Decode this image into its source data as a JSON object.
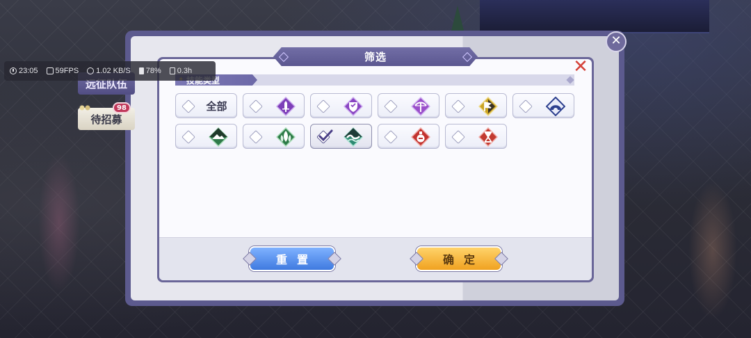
{
  "status": {
    "time": "23:05",
    "fps": "59FPS",
    "network": "1.02 KB/S",
    "battery": "78%",
    "session": "0.3h"
  },
  "side": {
    "expedition_label": "远征队伍",
    "recruit_label": "待招募",
    "recruit_count": "98"
  },
  "dialog": {
    "title": "筛选",
    "close_icon": "close-x-icon",
    "section_label": "技能类型",
    "options": [
      {
        "label": "全部",
        "icon": null,
        "selected": false
      },
      {
        "icon": "sword-gem-icon",
        "color": "#7d3fb8",
        "selected": false
      },
      {
        "icon": "shield-gem-icon",
        "color": "#8a45c2",
        "selected": false
      },
      {
        "icon": "bow-gem-icon",
        "color": "#9a4fca",
        "selected": false
      },
      {
        "icon": "flag-gem-icon",
        "color": "#c9a324",
        "selected": false
      },
      {
        "icon": "dome-gem-icon",
        "color": "#2c3f8e",
        "selected": false
      },
      {
        "icon": "mountain-gem-icon",
        "color": "#2f7a4a",
        "selected": false
      },
      {
        "icon": "leaf-gem-icon",
        "color": "#2e7b48",
        "selected": false
      },
      {
        "icon": "wave-gem-icon",
        "color": "#2d8a72",
        "selected": true
      },
      {
        "icon": "potion-gem-icon",
        "color": "#c2332f",
        "selected": false
      },
      {
        "icon": "hourglass-gem-icon",
        "color": "#c23a30",
        "selected": false
      }
    ],
    "reset_label": "重置",
    "confirm_label": "确定"
  }
}
